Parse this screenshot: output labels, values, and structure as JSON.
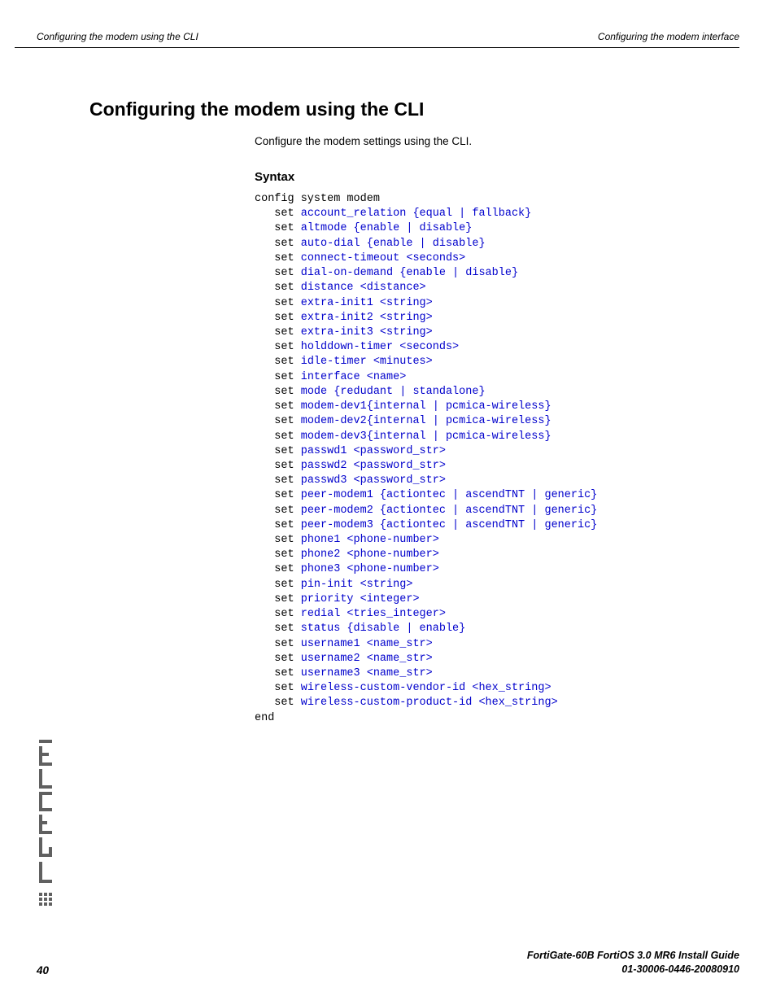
{
  "header": {
    "left": "Configuring the modem using the CLI",
    "right": "Configuring the modem interface"
  },
  "h1": "Configuring the modem using the CLI",
  "intro": "Configure the modem settings using the CLI.",
  "h2": "Syntax",
  "code": {
    "start": "config system modem",
    "lines": [
      "account_relation {equal | fallback}",
      "altmode {enable | disable}",
      "auto-dial {enable | disable}",
      "connect-timeout <seconds>",
      "dial-on-demand {enable | disable}",
      "distance <distance>",
      "extra-init1 <string>",
      "extra-init2 <string>",
      "extra-init3 <string>",
      "holddown-timer <seconds>",
      "idle-timer <minutes>",
      "interface <name>",
      "mode {redudant | standalone}",
      "modem-dev1{internal | pcmica-wireless}",
      "modem-dev2{internal | pcmica-wireless}",
      "modem-dev3{internal | pcmica-wireless}",
      "passwd1 <password_str>",
      "passwd2 <password_str>",
      "passwd3 <password_str>",
      "peer-modem1 {actiontec | ascendTNT | generic}",
      "peer-modem2 {actiontec | ascendTNT | generic}",
      "peer-modem3 {actiontec | ascendTNT | generic}",
      "phone1 <phone-number>",
      "phone2 <phone-number>",
      "phone3 <phone-number>",
      "pin-init <string>",
      "priority <integer>",
      "redial <tries_integer>",
      "status {disable | enable}",
      "username1 <name_str>",
      "username2 <name_str>",
      "username3 <name_str>",
      "wireless-custom-vendor-id <hex_string>",
      "wireless-custom-product-id <hex_string>"
    ],
    "set_word": "set",
    "end": "end"
  },
  "footer": {
    "page_number": "40",
    "line1": "FortiGate-60B FortiOS 3.0 MR6 Install Guide",
    "line2": "01-30006-0446-20080910"
  }
}
